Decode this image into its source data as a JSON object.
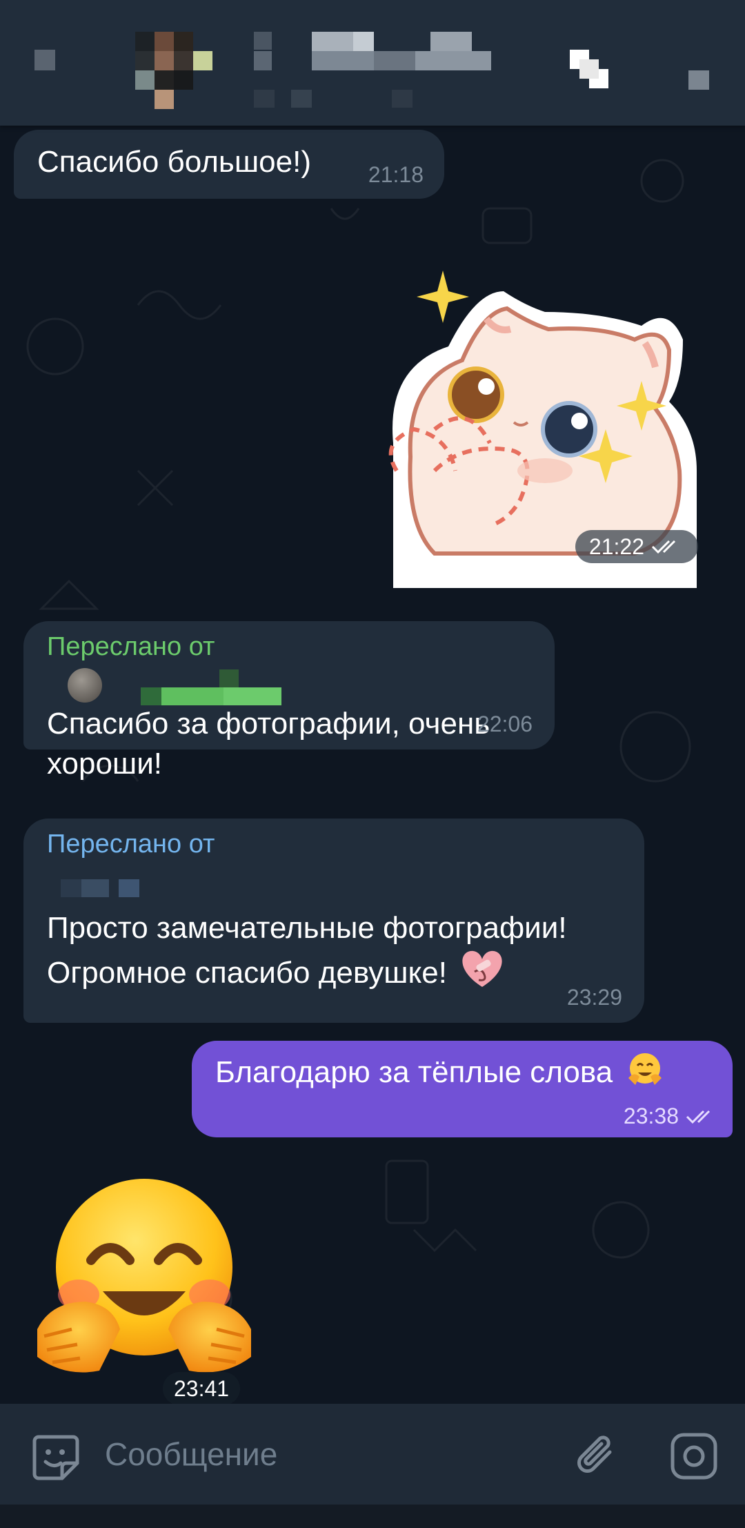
{
  "header": {
    "name_blurred": true
  },
  "messages": [
    {
      "id": "m1",
      "direction": "in",
      "text": "Спасибо большое!)",
      "time": "21:18"
    },
    {
      "id": "m2",
      "direction": "out",
      "type": "sticker",
      "sticker_icon": "cat-sticker-icon",
      "time": "21:22",
      "read": true
    },
    {
      "id": "m3",
      "direction": "in",
      "forwarded_label": "Переслано от",
      "text_line1": "Спасибо за фотографии, очень",
      "text_line2": "хороши!",
      "time": "22:06"
    },
    {
      "id": "m4",
      "direction": "in",
      "forwarded_label": "Переслано от",
      "text_line1": "Просто замечательные фотографии!",
      "text_line2": "Огромное спасибо девушке!",
      "emoji": "heart-bandage-emoji",
      "time": "23:29"
    },
    {
      "id": "m5",
      "direction": "out",
      "text": "Благодарю за тёплые слова",
      "emoji": "hugging-face-emoji",
      "time": "23:38",
      "read": true
    },
    {
      "id": "m6",
      "direction": "in",
      "type": "emoji",
      "emoji": "hugging-face-emoji",
      "time": "23:41"
    }
  ],
  "input": {
    "placeholder": "Сообщение"
  },
  "colors": {
    "background": "#0e1621",
    "bubble_in": "#212d3b",
    "bubble_out": "#7251d6",
    "forward_green": "#6ccb6c",
    "forward_blue": "#74b5ee"
  }
}
